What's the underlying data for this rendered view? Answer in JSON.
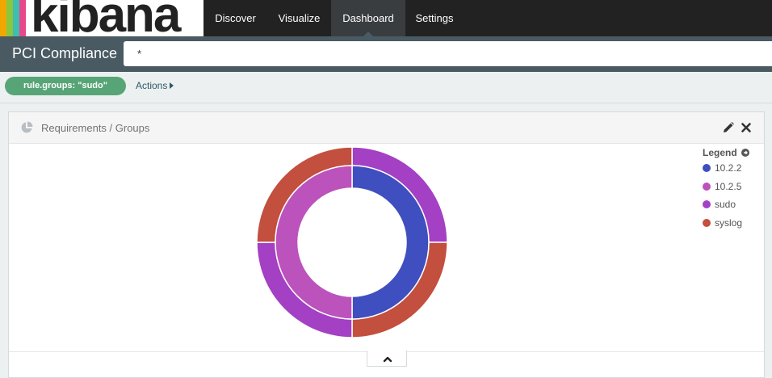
{
  "app": {
    "logo_text": "kibana",
    "logo_colors": [
      "#e8478b",
      "#3ebeb0",
      "#8cc63f",
      "#f0a800",
      "#e8478b"
    ]
  },
  "nav": {
    "tabs": [
      {
        "label": "Discover",
        "active": false
      },
      {
        "label": "Visualize",
        "active": false
      },
      {
        "label": "Dashboard",
        "active": true
      },
      {
        "label": "Settings",
        "active": false
      }
    ]
  },
  "dashboard": {
    "title": "PCI Compliance",
    "query": "*"
  },
  "filters": {
    "pill_label": "rule.groups: \"sudo\"",
    "actions_label": "Actions"
  },
  "panel": {
    "title": "Requirements / Groups",
    "edit_icon": "pencil-icon",
    "close_icon": "close-icon",
    "legend_title": "Legend"
  },
  "colors": {
    "topnav": "#222222",
    "searchbar": "#4a5a63",
    "filter_pill": "#57a577"
  },
  "chart_data": {
    "type": "pie",
    "donut": true,
    "inner": {
      "level": "requirements",
      "slices": [
        {
          "name": "10.2.2",
          "value": 50,
          "color": "#3f4fbf"
        },
        {
          "name": "10.2.5",
          "value": 50,
          "color": "#bc52bc"
        }
      ]
    },
    "outer": {
      "level": "groups",
      "slices": [
        {
          "name": "sudo",
          "value": 25,
          "color": "#a340c4"
        },
        {
          "name": "syslog",
          "value": 25,
          "color": "#c34f3e"
        },
        {
          "name": "sudo",
          "value": 25,
          "color": "#a340c4"
        },
        {
          "name": "syslog",
          "value": 25,
          "color": "#c34f3e"
        }
      ]
    },
    "legend": [
      {
        "name": "10.2.2",
        "color": "#3f4fbf"
      },
      {
        "name": "10.2.5",
        "color": "#bc52bc"
      },
      {
        "name": "sudo",
        "color": "#a340c4"
      },
      {
        "name": "syslog",
        "color": "#c34f3e"
      }
    ],
    "legend_position": "right"
  }
}
